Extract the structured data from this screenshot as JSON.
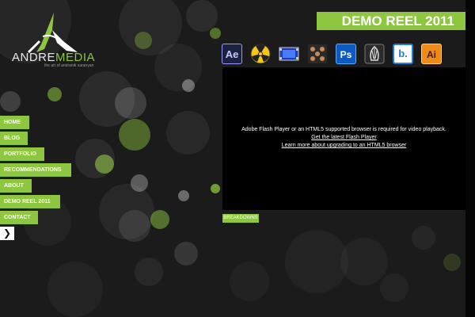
{
  "logo": {
    "brand_main": "ANDRE",
    "brand_accent": "MEDIA",
    "tagline": "the art of andranik saranyan"
  },
  "nav": [
    {
      "label": "HOME"
    },
    {
      "label": "BLOG"
    },
    {
      "label": "PORTFOLIO"
    },
    {
      "label": "RECOMMENDATIONS"
    },
    {
      "label": "ABOUT"
    },
    {
      "label": "DEMO REEL 2011"
    },
    {
      "label": "CONTACT"
    }
  ],
  "nav_arrow": "❯",
  "page_title": "DEMO REEL 2011",
  "tools": [
    {
      "name": "after-effects-icon",
      "text": "Ae"
    },
    {
      "name": "nuke-icon",
      "text": ""
    },
    {
      "name": "film-clip-icon",
      "text": ""
    },
    {
      "name": "node-pattern-icon",
      "text": ""
    },
    {
      "name": "photoshop-icon",
      "text": "Ps"
    },
    {
      "name": "shell-icon",
      "text": ""
    },
    {
      "name": "b-logo-icon",
      "text": "b."
    },
    {
      "name": "illustrator-icon",
      "text": "Ai"
    }
  ],
  "player": {
    "message": "Adobe Flash Player or an HTML5 supported browser is required for video playback.",
    "link1": "Get the latest Flash Player",
    "link2": "Learn more about upgrading to an HTML5 browser"
  },
  "breakdown_label": "BREAKDOWNS",
  "colors": {
    "accent": "#8dc63f",
    "background": "#1b1b1b",
    "player": "#000000"
  }
}
